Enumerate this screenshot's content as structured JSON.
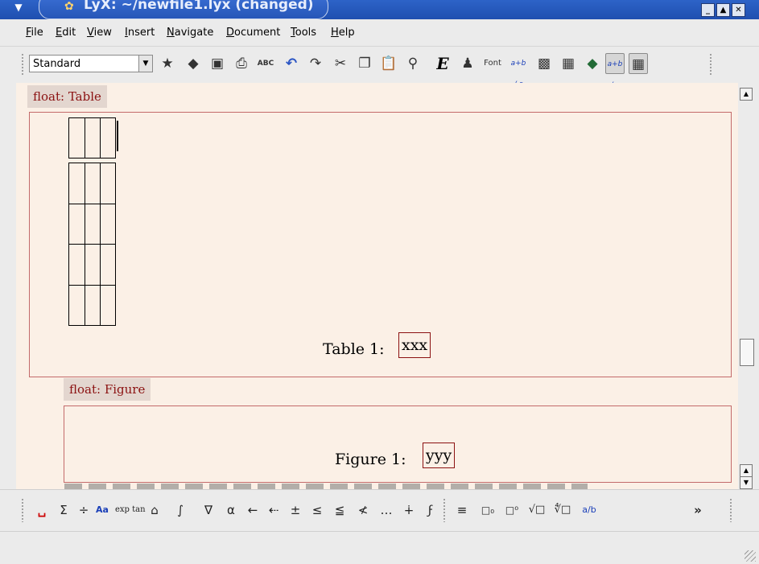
{
  "window": {
    "title": "LyX: ~/newfile1.lyx (changed)"
  },
  "menu": {
    "items": [
      "File",
      "Edit",
      "View",
      "Insert",
      "Navigate",
      "Document",
      "Tools",
      "Help"
    ],
    "mnemonics": [
      "F",
      "E",
      "V",
      "I",
      "N",
      "D",
      "T",
      "H"
    ]
  },
  "toolbar": {
    "layout_value": "Standard",
    "abc_label": "ABC",
    "font_label": "Font",
    "emph_label": "E",
    "math_label": "a+b / c"
  },
  "document": {
    "table_float_label": "float: Table",
    "table_caption_prefix": "Table 1:",
    "table_caption_text": "xxx",
    "figure_float_label": "float: Figure",
    "figure_caption_prefix": "Figure 1:",
    "figure_caption_text": "yyy"
  },
  "math_toolbar": {
    "items": [
      "␣",
      "Σ",
      "÷",
      "Aa",
      "exp tan",
      "⌂",
      "∫",
      "∇",
      "α",
      "←",
      "⇠",
      "±",
      "≤",
      "≦",
      "≮",
      "…",
      "∔",
      "ϝ",
      "≡",
      "□₀",
      "□⁰",
      "√□",
      "∜□",
      "a/b",
      "»"
    ]
  },
  "colors": {
    "title_bar": "#2d63c8",
    "document_bg": "#fbf0e6",
    "float_label_text": "#8b1111",
    "float_border": "#c36a6a"
  },
  "icons": {
    "toolbar": [
      "new-document-icon",
      "open-icon",
      "save-icon",
      "print-icon",
      "spellcheck-icon",
      "undo-icon",
      "redo-icon",
      "cut-icon",
      "copy-icon",
      "paste-icon",
      "find-icon",
      "emphasis-icon",
      "figure-icon",
      "font-icon",
      "math-icon",
      "image-icon",
      "table-icon",
      "bookmark-icon",
      "math-panel-icon",
      "table-panel-icon"
    ]
  }
}
